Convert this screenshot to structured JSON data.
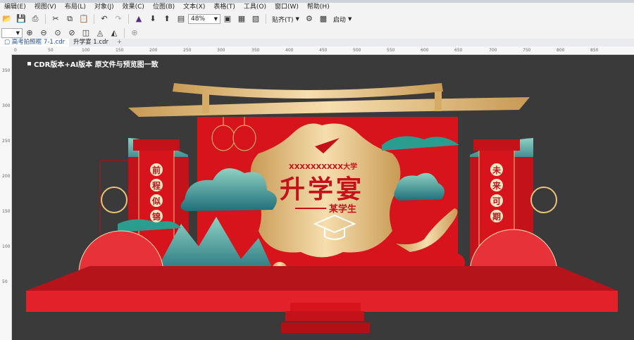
{
  "menu": {
    "items": [
      "编辑(E)",
      "视图(V)",
      "布局(L)",
      "对象(J)",
      "效果(C)",
      "位图(B)",
      "文本(X)",
      "表格(T)",
      "工具(O)",
      "窗口(W)",
      "帮助(H)"
    ]
  },
  "toolbar": {
    "zoom_value": "48%",
    "snap_label": "贴齐(T)",
    "launch_label": "启动"
  },
  "tabs": [
    {
      "label": "高考拍照框 7-1.cdr",
      "active": true
    },
    {
      "label": "升学宴 1.cdr",
      "active": false
    }
  ],
  "ruler": {
    "h_ticks": [
      "0",
      "50",
      "100",
      "150",
      "200",
      "250",
      "300",
      "350",
      "400",
      "450",
      "500",
      "550",
      "600",
      "650",
      "700",
      "750",
      "800",
      "850"
    ],
    "v_ticks": [
      "350",
      "300",
      "250",
      "200",
      "150",
      "100",
      "50"
    ]
  },
  "design": {
    "caption": "CDR版本+AI版本  原文件与预览图一致",
    "university": "XXXXXXXXXX大学",
    "title": "升学宴",
    "subtitle": "某学生",
    "left_banner": [
      "前",
      "程",
      "似",
      "锦"
    ],
    "right_banner": [
      "未",
      "来",
      "可",
      "期"
    ]
  },
  "colors": {
    "red": "#d7141c",
    "dark_red": "#b30f17",
    "gold": "#e0b873",
    "teal": "#2a9d8f",
    "canvas": "#3a3a3a"
  }
}
